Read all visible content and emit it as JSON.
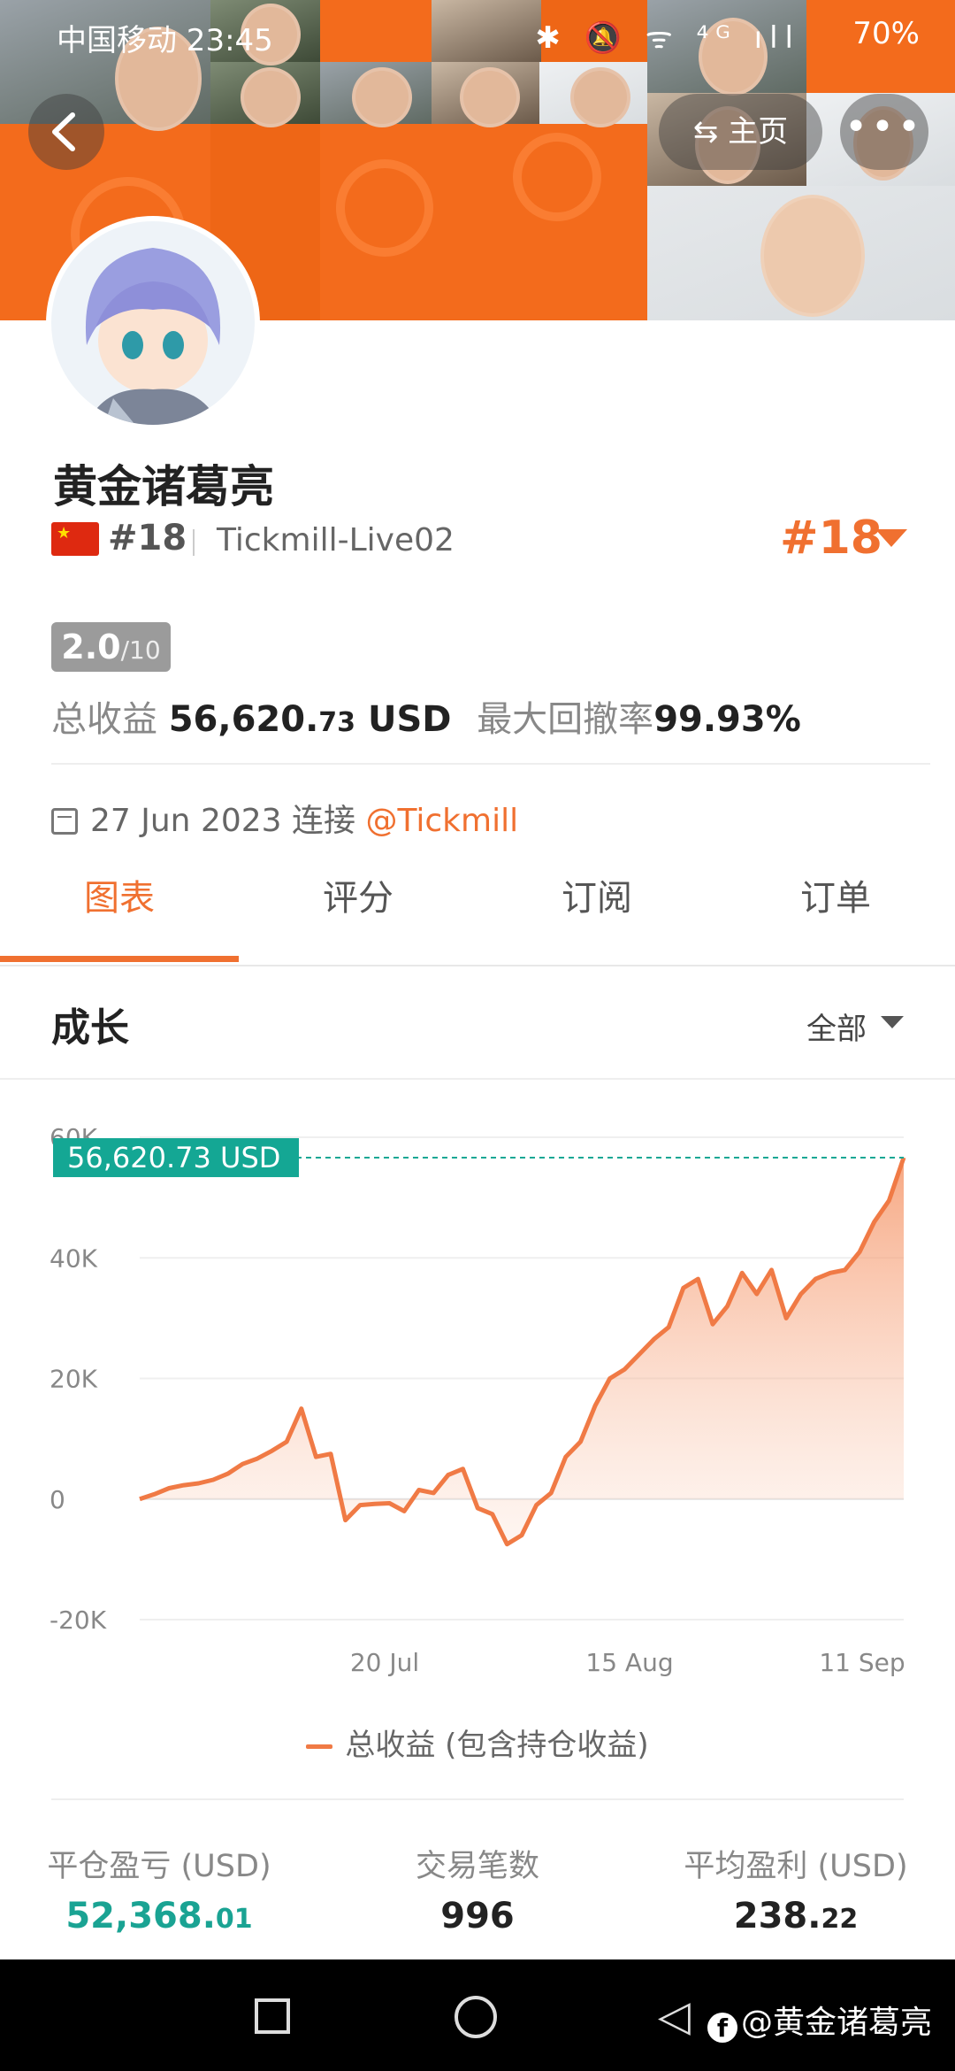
{
  "status_bar": {
    "carrier_time": "中国移动 23:45",
    "icons": "✱ 🔕 ᯤ ⁴ᴳ ıll",
    "battery": "70%"
  },
  "header": {
    "back_icon": "back-chevron-icon",
    "home_label": "⇆ 主页",
    "more_label": "•••"
  },
  "profile": {
    "name": "黄金诸葛亮",
    "rank_left": "#18",
    "broker": "Tickmill-Live02",
    "rank_right": "#18",
    "score_main": "2.0",
    "score_sub": "/10",
    "total_profit_label": "总收益",
    "total_profit_int": "56,620.",
    "total_profit_dec": "73",
    "total_profit_unit": "USD",
    "max_drawdown_label": "最大回撤率",
    "max_drawdown_value": "99.93%",
    "join_date": "27 Jun 2023",
    "join_text": "连接",
    "join_link": "@Tickmill"
  },
  "tabs": [
    {
      "label": "图表"
    },
    {
      "label": "评分"
    },
    {
      "label": "订阅"
    },
    {
      "label": "订单"
    }
  ],
  "growth": {
    "title": "成长",
    "range": "全部"
  },
  "chart_data": {
    "type": "area",
    "current_value_label": "56,620.73 USD",
    "current_value": 56620.73,
    "y_ticks": [
      "60K",
      "40K",
      "20K",
      "0",
      "-20K"
    ],
    "ylim": [
      -20000,
      60000
    ],
    "x_ticks": [
      "20 Jul",
      "15 Aug",
      "11 Sep"
    ],
    "series": [
      {
        "name": "总收益 (包含持仓收益)",
        "color": "#f07a45",
        "values": [
          0,
          800,
          1800,
          2300,
          2600,
          3200,
          4200,
          5800,
          6700,
          8000,
          9500,
          15000,
          7000,
          7500,
          -3500,
          -1000,
          -800,
          -700,
          -2000,
          1500,
          1000,
          4000,
          5000,
          -1500,
          -2500,
          -7500,
          -6000,
          -1000,
          1000,
          7000,
          9500,
          15500,
          20000,
          21500,
          24000,
          26500,
          28500,
          35000,
          36500,
          29000,
          32000,
          37500,
          34000,
          38000,
          30000,
          34000,
          36500,
          37500,
          38000,
          41000,
          46000,
          49500,
          56620.73
        ]
      }
    ]
  },
  "legend": {
    "label": "总收益 (包含持仓收益)"
  },
  "metrics": [
    {
      "label": "平仓盈亏 (USD)",
      "int": "52,368.",
      "dec": "01",
      "color": "#1aa393"
    },
    {
      "label": "交易笔数",
      "int": "996",
      "dec": "",
      "color": "#222222"
    },
    {
      "label": "平均盈利 (USD)",
      "int": "238.",
      "dec": "22",
      "color": "#222222"
    }
  ],
  "watermark": {
    "fb_letter": "f",
    "text": "@黄金诸葛亮"
  },
  "colors": {
    "accent": "#f07030",
    "teal": "#14a794"
  }
}
